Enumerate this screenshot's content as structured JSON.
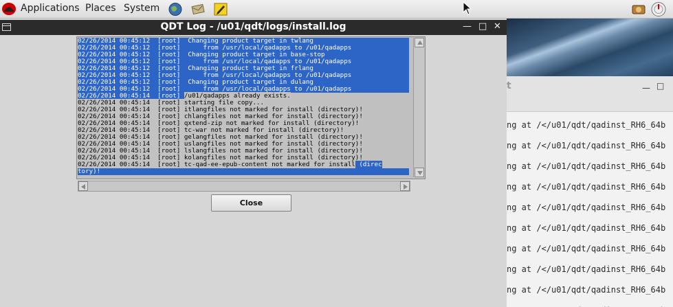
{
  "panel": {
    "menus": [
      "Applications",
      "Places",
      "System"
    ]
  },
  "dialog": {
    "title": "QDT Log - /u01/qdt/logs/install.log",
    "close_label": "Close",
    "log_lines": [
      "02/26/2014 00:45:12  [root]  Changing product target in twlang",
      "02/26/2014 00:45:12  [root]      from /usr/local/qadapps to /u01/qadapps",
      "02/26/2014 00:45:12  [root]  Changing product target in base-stop",
      "02/26/2014 00:45:12  [root]      from /usr/local/qadapps to /u01/qadapps",
      "02/26/2014 00:45:12  [root]  Changing product target in frlang",
      "02/26/2014 00:45:12  [root]      from /usr/local/qadapps to /u01/qadapps",
      "02/26/2014 00:45:12  [root]  Changing product target in dulang",
      "02/26/2014 00:45:12  [root]      from /usr/local/qadapps to /u01/qadapps"
    ],
    "log_lines_unselected": [
      {
        "pre": "02/26/2014 00:45:14  [root] ",
        "txt": "/u01/qadapps already exists.",
        "tail": ""
      },
      {
        "pre": "",
        "txt": "02/26/2014 00:45:14  [root] starting file copy...",
        "tail": ""
      },
      {
        "pre": "",
        "txt": "02/26/2014 00:45:14  [root] itlangfiles not marked for install (directory)!",
        "tail": ""
      },
      {
        "pre": "",
        "txt": "02/26/2014 00:45:14  [root] chlangfiles not marked for install (directory)!",
        "tail": ""
      },
      {
        "pre": "",
        "txt": "02/26/2014 00:45:14  [root] qxtend-zip not marked for install (directory)!",
        "tail": ""
      },
      {
        "pre": "",
        "txt": "02/26/2014 00:45:14  [root] tc-war not marked for install (directory)!",
        "tail": ""
      },
      {
        "pre": "",
        "txt": "02/26/2014 00:45:14  [root] gelangfiles not marked for install (directory)!",
        "tail": ""
      },
      {
        "pre": "",
        "txt": "02/26/2014 00:45:14  [root] uslangfiles not marked for install (directory)!",
        "tail": ""
      },
      {
        "pre": "",
        "txt": "02/26/2014 00:45:14  [root] lslangfiles not marked for install (directory)!",
        "tail": ""
      },
      {
        "pre": "",
        "txt": "02/26/2014 00:45:14  [root] kolangfiles not marked for install (directory)!",
        "tail": ""
      },
      {
        "pre": "",
        "txt": "02/26/2014 00:45:14  [root] tc-qad-ee-epub-content not marked for install",
        "tail": " (direc"
      }
    ],
    "log_tail": "tory)!"
  },
  "background_window": {
    "title_fragment": "t",
    "line_text": "ng at /</u01/qdt/qadinst_RH6_64b",
    "line_count": 10
  }
}
